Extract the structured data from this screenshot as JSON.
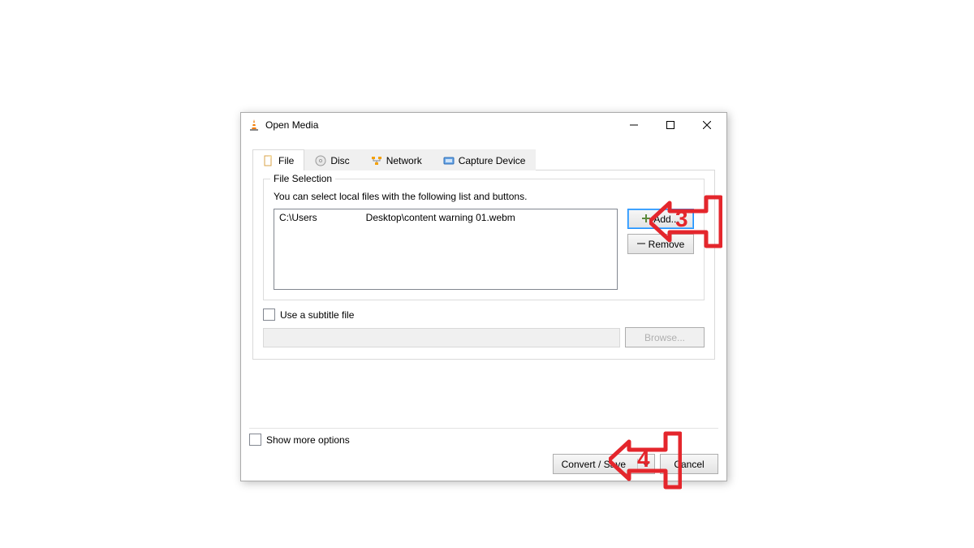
{
  "window": {
    "title": "Open Media"
  },
  "tabs": {
    "file": "File",
    "disc": "Disc",
    "network": "Network",
    "capture": "Capture Device"
  },
  "file_selection": {
    "legend": "File Selection",
    "help": "You can select local files with the following list and buttons.",
    "item": "C:\\Users                  Desktop\\content warning 01.webm",
    "add": "Add...",
    "remove": "Remove"
  },
  "subtitle": {
    "checkbox_label": "Use a subtitle file",
    "browse": "Browse..."
  },
  "show_more": "Show more options",
  "actions": {
    "convert": "Convert / Save",
    "cancel": "Cancel"
  },
  "annotations": {
    "step3": "3",
    "step4": "4"
  }
}
